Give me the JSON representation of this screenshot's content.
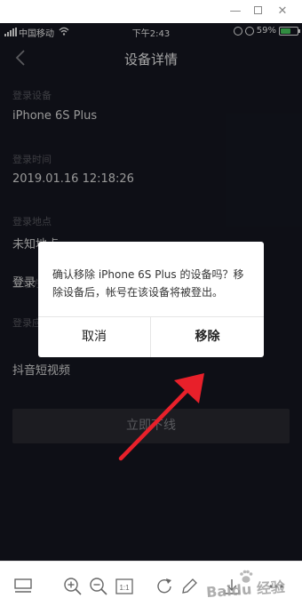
{
  "window": {
    "title_buttons": [
      "minimize-icon",
      "maximize-icon",
      "close-icon"
    ]
  },
  "status_bar": {
    "carrier": "中国移动",
    "time": "下午2:43",
    "battery": "59%",
    "battery_level": 0.59
  },
  "nav": {
    "title": "设备详情"
  },
  "details": [
    {
      "label": "登录设备",
      "value": "iPhone 6S Plus"
    },
    {
      "label": "登录时间",
      "value": "2019.01.16 12:18:26"
    },
    {
      "label": "登录地点",
      "value": "未知地点"
    },
    {
      "label": "登录方式",
      "value": "登录"
    },
    {
      "label": "登录应用",
      "value": "抖音短视频"
    }
  ],
  "offline_button": "立即下线",
  "dialog": {
    "message": "确认移除 iPhone 6S Plus 的设备吗？移除设备后，帐号在该设备将被登出。",
    "cancel": "取消",
    "confirm": "移除"
  },
  "watermark": {
    "text": "Baidu 经验"
  },
  "colors": {
    "background": "#161823",
    "arrow": "#e8202a",
    "dialog": "#ffffff"
  }
}
